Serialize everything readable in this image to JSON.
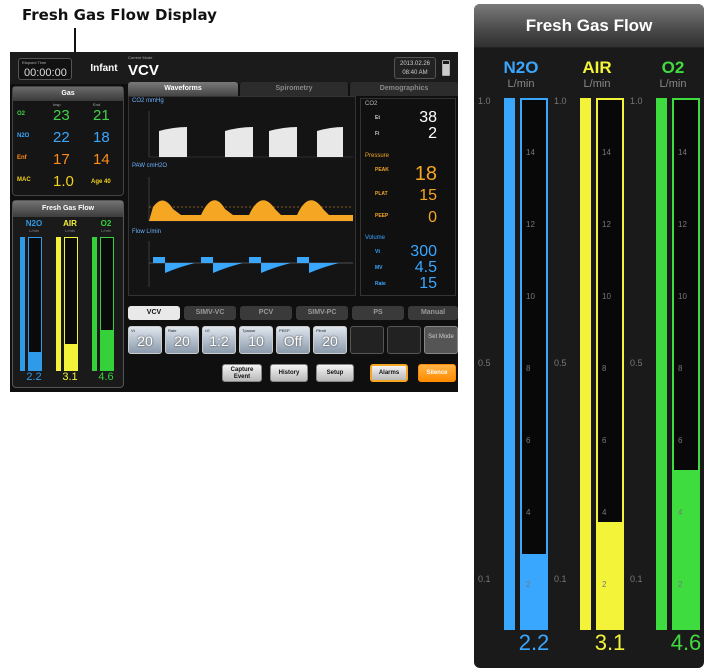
{
  "callout": {
    "title": "Fresh Gas Flow Display"
  },
  "small_screen": {
    "elapsed_label": "Elapsed Time",
    "elapsed_value": "00:00:00",
    "patient": "Infant",
    "mode_label": "Current Mode",
    "mode_value": "VCV",
    "date": "2013.02.26",
    "time": "08:40 AM",
    "gas_title": "Gas",
    "gas_cols": [
      "Insp",
      "End"
    ],
    "gas_rows": [
      {
        "label": "O2",
        "insp": "23",
        "end": "21",
        "color": "#3fd44a"
      },
      {
        "label": "N2O",
        "insp": "22",
        "end": "18",
        "color": "#3aa7ff"
      },
      {
        "label": "Enf",
        "insp": "17",
        "end": "14",
        "color": "#ff8c1a"
      },
      {
        "label": "MAC",
        "insp": "1.0",
        "end": "",
        "extra": "Age 40",
        "color": "#f1d21b"
      }
    ],
    "fgf_title": "Fresh Gas Flow",
    "fgf": [
      {
        "name": "N2O",
        "value": "2.2",
        "color": "#2f9be8",
        "level": 0.14
      },
      {
        "name": "AIR",
        "value": "3.1",
        "color": "#f3f33a",
        "level": 0.2
      },
      {
        "name": "O2",
        "value": "4.6",
        "color": "#35d13a",
        "level": 0.3
      }
    ],
    "unit": "L/min",
    "tabs": [
      "Waveforms",
      "Spirometry",
      "Demographics"
    ],
    "wave_labels": [
      "CO2 mmHg",
      "PAW cmH2O",
      "Flow L/min"
    ],
    "co2_title": "CO2",
    "co2": [
      {
        "label": "Et",
        "value": "38"
      },
      {
        "label": "Fi",
        "value": "2"
      }
    ],
    "pressure_title": "Pressure",
    "pressure": [
      {
        "label": "PEAK",
        "value": "18"
      },
      {
        "label": "PLAT",
        "value": "15"
      },
      {
        "label": "PEEP",
        "value": "0"
      }
    ],
    "volume_title": "Volume",
    "volume": [
      {
        "label": "Vt",
        "value": "300"
      },
      {
        "label": "MV",
        "value": "4.5"
      },
      {
        "label": "Rate",
        "value": "15"
      }
    ],
    "mode_tabs": [
      "VCV",
      "SIMV-VC",
      "PCV",
      "SIMV-PC",
      "PS",
      "Manual"
    ],
    "settings": [
      {
        "label": "Vt",
        "value": "20"
      },
      {
        "label": "Rate",
        "value": "20"
      },
      {
        "label": "I:E",
        "value": "1:2"
      },
      {
        "label": "Tpause",
        "value": "10"
      },
      {
        "label": "PEEP",
        "value": "Off"
      },
      {
        "label": "Plimit",
        "value": "20"
      }
    ],
    "set_mode": "Set Mode",
    "bottom_buttons": {
      "capture": "Capture Event",
      "history": "History",
      "setup": "Setup",
      "alarms": "Alarms",
      "silence": "Silence"
    }
  },
  "large_panel": {
    "title": "Fresh Gas Flow",
    "unit": "L/min",
    "columns": [
      {
        "name": "N2O",
        "value": "2.2",
        "color": "#3aa7ff",
        "level": 0.14
      },
      {
        "name": "AIR",
        "value": "3.1",
        "color": "#f3f33a",
        "level": 0.2
      },
      {
        "name": "O2",
        "value": "4.6",
        "color": "#3fdc3f",
        "level": 0.3
      }
    ],
    "left_ticks": [
      "1.0",
      "0.5",
      "0.1"
    ],
    "inner_ticks": [
      "14",
      "12",
      "10",
      "8",
      "6",
      "4",
      "2"
    ]
  }
}
